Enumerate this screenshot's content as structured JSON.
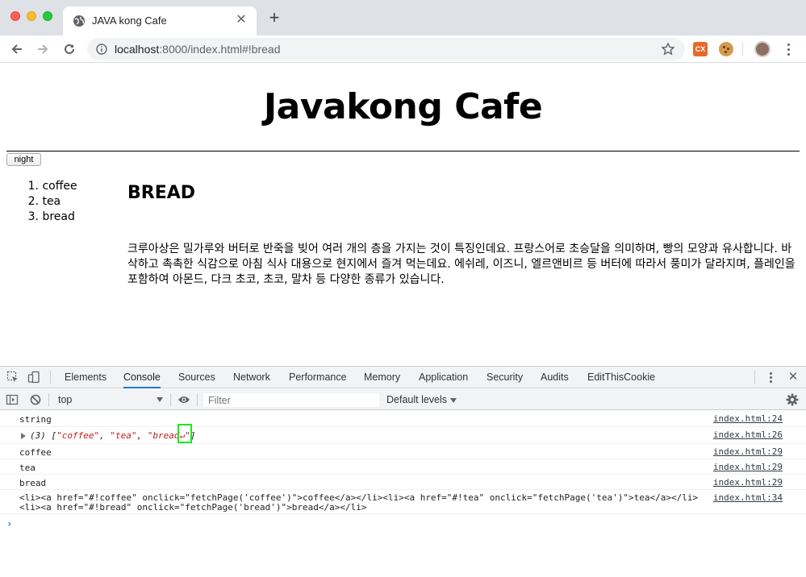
{
  "browser": {
    "tab_title": "JAVA kong Cafe",
    "tab_close": "✕",
    "new_tab": "+",
    "url_host": "localhost",
    "url_rest": ":8000/index.html#!bread",
    "extension_label": "CX"
  },
  "page": {
    "site_title": "Javakong Cafe",
    "night_button": "night",
    "menu": [
      {
        "num": "1.",
        "label": "coffee"
      },
      {
        "num": "2.",
        "label": "tea"
      },
      {
        "num": "3.",
        "label": "bread"
      }
    ],
    "content_title": "BREAD",
    "content_body": "크루아상은 밀가루와 버터로 반죽을 빚어 여러 개의 층을 가지는 것이 특징인데요. 프랑스어로 초승달을 의미하며, 빵의 모양과 유사합니다. 바삭하고 촉촉한 식감으로 아침 식사 대용으로 현지에서 즐겨 먹는데요. 에쉬레, 이즈니, 엘르앤비르 등 버터에 따라서 풍미가 달라지며, 플레인을 포함하여 아몬드, 다크 초코, 초코, 말차 등 다양한 종류가 있습니다."
  },
  "devtools": {
    "tabs": [
      "Elements",
      "Console",
      "Sources",
      "Network",
      "Performance",
      "Memory",
      "Application",
      "Security",
      "Audits",
      "EditThisCookie"
    ],
    "active_tab": "Console",
    "context": "top",
    "filter_placeholder": "Filter",
    "levels": "Default levels",
    "close": "✕",
    "logs": {
      "row1": {
        "msg": "string",
        "src": "index.html:24"
      },
      "row2": {
        "prefix": "(3) [",
        "s1": "\"coffee\"",
        "sep1": ", ",
        "s2": "\"tea\"",
        "sep2": ", ",
        "s3a": "\"bread",
        "s3b": "↵\"",
        "suffix": "]",
        "src": "index.html:26"
      },
      "row3": {
        "msg": "coffee",
        "src": "index.html:29"
      },
      "row4": {
        "msg": "tea",
        "src": "index.html:29"
      },
      "row5": {
        "msg": "bread",
        "src": "index.html:29"
      },
      "row6": {
        "line1": "<li><a href=\"#!coffee\" onclick=\"fetchPage('coffee')\">coffee</a></li><li><a href=\"#!tea\" onclick=\"fetchPage('tea')\">tea</a></li>",
        "line2": "<li><a href=\"#!bread\" onclick=\"fetchPage('bread')\">bread</a></li>",
        "src": "index.html:34"
      }
    },
    "prompt": "›"
  }
}
